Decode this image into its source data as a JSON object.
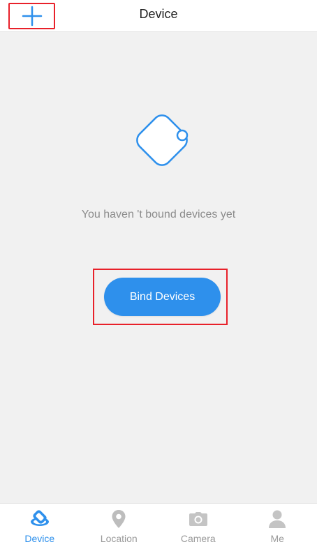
{
  "header": {
    "title": "Device",
    "add_icon": "plus-icon"
  },
  "empty_state": {
    "illustration_icon": "tag-device-icon",
    "message": "You haven 't bound devices yet",
    "bind_button_label": "Bind Devices"
  },
  "tabbar": {
    "tabs": [
      {
        "label": "Device",
        "icon": "device-icon",
        "active": true
      },
      {
        "label": "Location",
        "icon": "location-pin-icon",
        "active": false
      },
      {
        "label": "Camera",
        "icon": "camera-icon",
        "active": false
      },
      {
        "label": "Me",
        "icon": "person-icon",
        "active": false
      }
    ]
  },
  "colors": {
    "accent": "#2e90ec",
    "highlight_frame": "#e8212a",
    "inactive": "#bdbdbd",
    "background": "#f1f1f1"
  }
}
